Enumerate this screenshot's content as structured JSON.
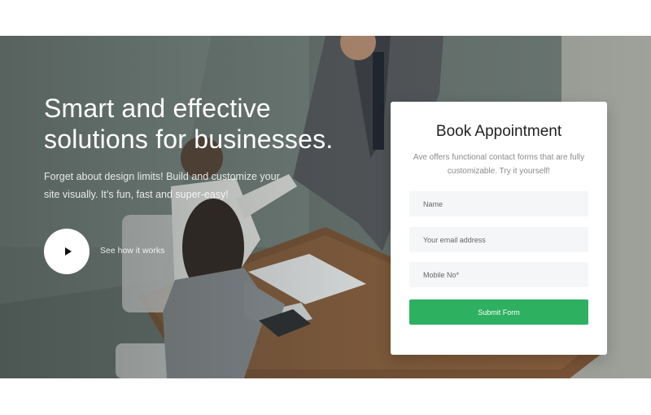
{
  "hero": {
    "headline": "Smart and effective solutions for businesses.",
    "subtext": "Forget about design limits! Build and customize your site visually. It’s fun, fast and super-easy!",
    "video_link_label": "See how it works",
    "play_icon": "play-icon"
  },
  "form": {
    "title": "Book Appointment",
    "description": "Ave offers functional contact forms that are fully customizable. Try it yourself!",
    "name_placeholder": "Name",
    "email_placeholder": "Your email address",
    "mobile_placeholder": "Mobile No*",
    "submit_label": "Submit Form"
  },
  "colors": {
    "submit_button": "#2eb061",
    "form_background": "#ffffff",
    "field_background": "#f5f6f7"
  }
}
